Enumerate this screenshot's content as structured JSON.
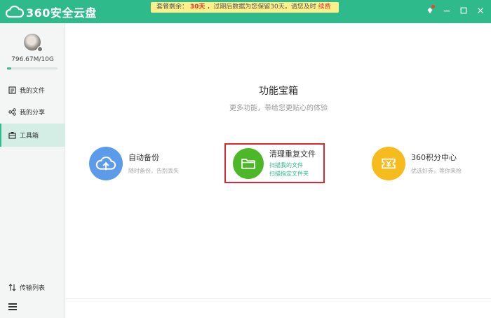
{
  "app": {
    "name": "360安全云盘",
    "brand_color": "#2fba8b"
  },
  "banner": {
    "prefix": "套餐剩余：",
    "days": "30天",
    "middle": "，过期后数据为您保留30天，请您及时",
    "action": "续费"
  },
  "window_controls": {
    "icons": [
      "skin-icon",
      "minimize-icon",
      "maximize-icon",
      "close-icon"
    ]
  },
  "sidebar": {
    "quota_text": "796.67M/10G",
    "quota_used_fraction": 0.078,
    "items": [
      {
        "label": "我的文件",
        "icon": "file-list-icon",
        "active": false
      },
      {
        "label": "我的分享",
        "icon": "share-icon",
        "active": false
      },
      {
        "label": "工具箱",
        "icon": "toolbox-icon",
        "active": true
      }
    ],
    "transfer_label": "传输列表",
    "menu_icon": "hamburger-menu-icon"
  },
  "main": {
    "title": "功能宝箱",
    "subtitle": "更多功能，带给您更贴心的体验",
    "tools": [
      {
        "name": "自动备份",
        "desc": "随时备份，告别丢失",
        "icon": "cloud-upload-icon",
        "color": "#5b9bea"
      },
      {
        "name": "清理重复文件",
        "links": [
          "扫描我的文件",
          "扫描指定文件夹"
        ],
        "icon": "folder-icon",
        "color": "#4cb727",
        "highlight_color": "#d9282f"
      },
      {
        "name": "360积分中心",
        "desc": "优选好券，等你来抢",
        "icon": "coupon-icon",
        "color": "#f6bc1d"
      }
    ]
  }
}
